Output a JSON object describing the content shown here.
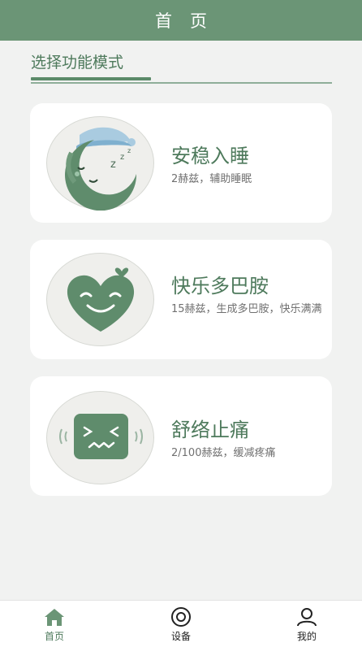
{
  "header": {
    "title": "首页"
  },
  "section": {
    "title": "选择功能模式"
  },
  "modes": [
    {
      "title": "安稳入睡",
      "desc": "2赫兹，辅助睡眠",
      "icon": "sleeping-moon-icon"
    },
    {
      "title": "快乐多巴胺",
      "desc": "15赫兹，生成多巴胺，快乐满满",
      "icon": "smiling-heart-icon"
    },
    {
      "title": "舒络止痛",
      "desc": "2/100赫兹，缓减疼痛",
      "icon": "pain-face-icon"
    }
  ],
  "tabbar": {
    "items": [
      {
        "label": "首页",
        "icon": "home-icon",
        "active": true
      },
      {
        "label": "设备",
        "icon": "device-icon",
        "active": false
      },
      {
        "label": "我的",
        "icon": "user-icon",
        "active": false
      }
    ]
  },
  "colors": {
    "primary": "#6b9576",
    "accent": "#4e7a5c",
    "background": "#f1f2f1"
  }
}
